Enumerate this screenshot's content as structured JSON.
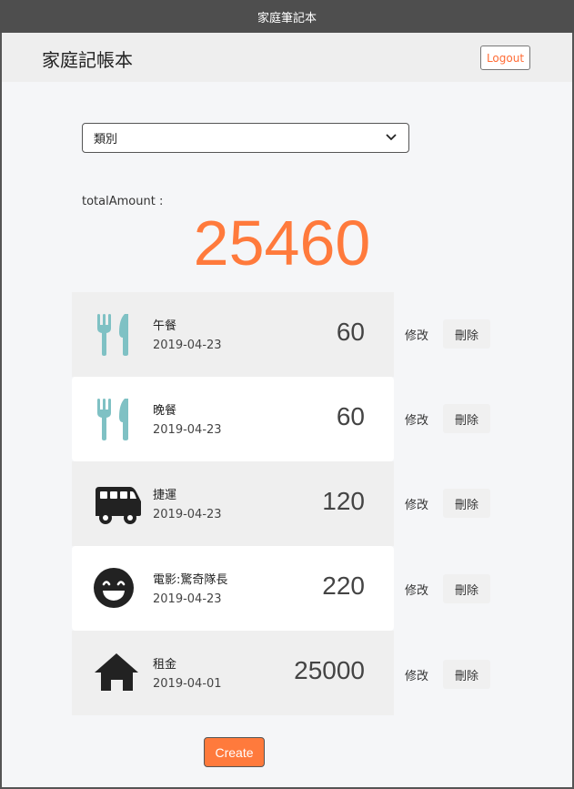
{
  "window": {
    "title": "家庭筆記本"
  },
  "nav": {
    "brand": "家庭記帳本",
    "logout_label": "Logout"
  },
  "filter": {
    "selected": "類別"
  },
  "total": {
    "label": "totalAmount :",
    "value": "25460"
  },
  "colors": {
    "accent": "#ff7a3c",
    "food_icon": "#7fc1c4",
    "dark_icon": "#222222"
  },
  "records": [
    {
      "icon": "fork-knife-icon",
      "name": "午餐",
      "date": "2019-04-23",
      "amount": "60",
      "edit_label": "修改",
      "delete_label": "刪除"
    },
    {
      "icon": "fork-knife-icon",
      "name": "晚餐",
      "date": "2019-04-23",
      "amount": "60",
      "edit_label": "修改",
      "delete_label": "刪除"
    },
    {
      "icon": "bus-icon",
      "name": "捷運",
      "date": "2019-04-23",
      "amount": "120",
      "edit_label": "修改",
      "delete_label": "刪除"
    },
    {
      "icon": "smile-icon",
      "name": "電影:驚奇隊長",
      "date": "2019-04-23",
      "amount": "220",
      "edit_label": "修改",
      "delete_label": "刪除"
    },
    {
      "icon": "home-icon",
      "name": "租金",
      "date": "2019-04-01",
      "amount": "25000",
      "edit_label": "修改",
      "delete_label": "刪除"
    }
  ],
  "actions": {
    "create_label": "Create"
  }
}
